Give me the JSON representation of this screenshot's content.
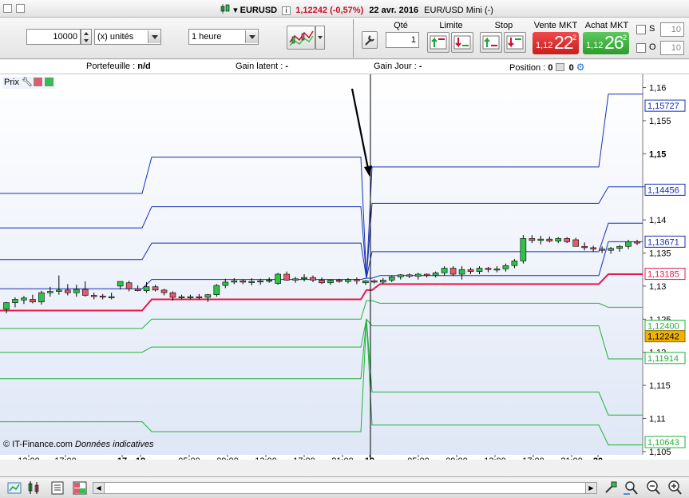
{
  "titlebar": {
    "symbol": "EURUSD",
    "price": "1,12242",
    "change": "(-0,57%)",
    "date": "22 avr. 2016",
    "instrument": "EUR/USD Mini (-)"
  },
  "toolbar": {
    "quantity": "10000",
    "unit": "(x) unités",
    "timeframe": "1 heure",
    "qty_label": "Qté",
    "qty_value": "1",
    "limit_label": "Limite",
    "stop_label": "Stop",
    "sell_label": "Vente MKT",
    "buy_label": "Achat MKT",
    "sell_pre": "1,12",
    "sell_big": "22",
    "sell_sup": "2",
    "buy_pre": "1,12",
    "buy_big": "26",
    "buy_sup": "2",
    "s_label": "S",
    "o_label": "O",
    "s_value": "10",
    "o_value": "10"
  },
  "infobar": {
    "portfolio_label": "Portefeuille :",
    "portfolio_value": "n/d",
    "latent_label": "Gain latent :",
    "latent_value": "-",
    "day_label": "Gain Jour :",
    "day_value": "-",
    "position_label": "Position :",
    "position_value": "0",
    "position_value2": "0"
  },
  "chart": {
    "prix_label": "Prix",
    "footer_source": "© IT-Finance.com",
    "footer_note": "Données indicatives"
  },
  "colors": {
    "up": "#2fc24a",
    "down": "#e05b6c",
    "mid_line": "#e8174a",
    "upper_band": "#1630b8",
    "lower_band": "#1fb23a",
    "current": "#f0b400"
  },
  "chart_data": {
    "type": "candlestick",
    "y_range": [
      1.104,
      1.162
    ],
    "y_ticks": [
      "1,16",
      "1,155",
      "1,15",
      "1,145",
      "1,14",
      "1,135",
      "1,13",
      "1,125",
      "1,12",
      "1,115",
      "1,11",
      "1,105"
    ],
    "x_labels": [
      {
        "label": "13:00",
        "bold": false
      },
      {
        "label": "17:00",
        "bold": false
      },
      {
        "label": "17",
        "bold": true
      },
      {
        "label": "18",
        "bold": true
      },
      {
        "label": "05:00",
        "bold": false
      },
      {
        "label": "09:00",
        "bold": false
      },
      {
        "label": "13:00",
        "bold": false
      },
      {
        "label": "17:00",
        "bold": false
      },
      {
        "label": "21:00",
        "bold": false
      },
      {
        "label": "19",
        "bold": true
      },
      {
        "label": "05:00",
        "bold": false
      },
      {
        "label": "09:00",
        "bold": false
      },
      {
        "label": "13:00",
        "bold": false
      },
      {
        "label": "17:00",
        "bold": false
      },
      {
        "label": "21:00",
        "bold": false
      },
      {
        "label": "20",
        "bold": true
      }
    ],
    "price_tags": [
      {
        "value": "1,15727",
        "kind": "upper",
        "price": 1.15727
      },
      {
        "value": "1,14456",
        "kind": "upper",
        "price": 1.14456
      },
      {
        "value": "1,13671",
        "kind": "upper",
        "price": 1.13671
      },
      {
        "value": "1,13185",
        "kind": "mid",
        "price": 1.13185
      },
      {
        "value": "1,12400",
        "kind": "lower",
        "price": 1.124
      },
      {
        "value": "1,12242",
        "kind": "current",
        "price": 1.12242
      },
      {
        "value": "1,11914",
        "kind": "lower",
        "price": 1.11914
      },
      {
        "value": "1,10643",
        "kind": "lower",
        "price": 1.10643
      }
    ],
    "candles": [
      [
        1.1265,
        1.1276,
        1.1259,
        1.1275
      ],
      [
        1.1275,
        1.1283,
        1.1268,
        1.128
      ],
      [
        1.1279,
        1.1285,
        1.1273,
        1.1282
      ],
      [
        1.128,
        1.1287,
        1.1274,
        1.1276
      ],
      [
        1.1276,
        1.1293,
        1.1272,
        1.129
      ],
      [
        1.129,
        1.1299,
        1.1284,
        1.1292
      ],
      [
        1.1292,
        1.1316,
        1.1287,
        1.1294
      ],
      [
        1.1294,
        1.1303,
        1.1286,
        1.129
      ],
      [
        1.129,
        1.1302,
        1.1284,
        1.1295
      ],
      [
        1.1295,
        1.1307,
        1.1284,
        1.1286
      ],
      [
        1.1286,
        1.129,
        1.128,
        1.1285
      ],
      [
        1.1285,
        1.1288,
        1.128,
        1.1284
      ],
      [
        1.1284,
        1.129,
        1.128,
        1.1284
      ],
      [
        1.13,
        1.1307,
        1.1295,
        1.1307
      ],
      [
        1.1305,
        1.1308,
        1.1292,
        1.1296
      ],
      [
        1.1296,
        1.1301,
        1.1292,
        1.1293
      ],
      [
        1.1293,
        1.1306,
        1.129,
        1.1299
      ],
      [
        1.1299,
        1.1302,
        1.1292,
        1.1294
      ],
      [
        1.1294,
        1.1296,
        1.1286,
        1.129
      ],
      [
        1.129,
        1.1292,
        1.1278,
        1.1283
      ],
      [
        1.1283,
        1.1287,
        1.128,
        1.1284
      ],
      [
        1.1284,
        1.1287,
        1.128,
        1.1284
      ],
      [
        1.1284,
        1.1288,
        1.128,
        1.1283
      ],
      [
        1.1283,
        1.1288,
        1.1276,
        1.1287
      ],
      [
        1.1287,
        1.1303,
        1.1284,
        1.1301
      ],
      [
        1.1301,
        1.1311,
        1.1297,
        1.1306
      ],
      [
        1.1306,
        1.1312,
        1.1303,
        1.1308
      ],
      [
        1.1308,
        1.131,
        1.1303,
        1.1306
      ],
      [
        1.1306,
        1.1312,
        1.1301,
        1.1307
      ],
      [
        1.1307,
        1.1311,
        1.1302,
        1.1308
      ],
      [
        1.1308,
        1.1313,
        1.1305,
        1.1309
      ],
      [
        1.1304,
        1.132,
        1.1302,
        1.1318
      ],
      [
        1.1318,
        1.1322,
        1.1308,
        1.1309
      ],
      [
        1.1309,
        1.1314,
        1.1305,
        1.1311
      ],
      [
        1.1311,
        1.1318,
        1.1307,
        1.1313
      ],
      [
        1.1313,
        1.1316,
        1.1306,
        1.1309
      ],
      [
        1.1309,
        1.1313,
        1.1303,
        1.1305
      ],
      [
        1.1305,
        1.131,
        1.1302,
        1.1309
      ],
      [
        1.1309,
        1.1311,
        1.1305,
        1.1307
      ],
      [
        1.1307,
        1.1312,
        1.1304,
        1.131
      ],
      [
        1.131,
        1.1313,
        1.1303,
        1.1308
      ],
      [
        1.1305,
        1.1309,
        1.1302,
        1.1308
      ],
      [
        1.1308,
        1.131,
        1.1304,
        1.1306
      ],
      [
        1.1306,
        1.1312,
        1.1303,
        1.1309
      ],
      [
        1.1309,
        1.1316,
        1.1306,
        1.1314
      ],
      [
        1.1314,
        1.1318,
        1.131,
        1.1317
      ],
      [
        1.1317,
        1.1319,
        1.1312,
        1.1315
      ],
      [
        1.1315,
        1.132,
        1.131,
        1.1318
      ],
      [
        1.1318,
        1.1319,
        1.1313,
        1.1316
      ],
      [
        1.1316,
        1.1322,
        1.1313,
        1.132
      ],
      [
        1.132,
        1.133,
        1.1316,
        1.1327
      ],
      [
        1.1327,
        1.133,
        1.1315,
        1.1318
      ],
      [
        1.1318,
        1.133,
        1.131,
        1.1325
      ],
      [
        1.1325,
        1.1328,
        1.1318,
        1.1322
      ],
      [
        1.1322,
        1.133,
        1.1318,
        1.1327
      ],
      [
        1.1327,
        1.1329,
        1.1321,
        1.1325
      ],
      [
        1.1325,
        1.133,
        1.1321,
        1.1326
      ],
      [
        1.1326,
        1.1334,
        1.1322,
        1.1331
      ],
      [
        1.1331,
        1.1341,
        1.1327,
        1.1338
      ],
      [
        1.1338,
        1.1377,
        1.1334,
        1.1372
      ],
      [
        1.1372,
        1.1377,
        1.1365,
        1.1369
      ],
      [
        1.1369,
        1.1376,
        1.1363,
        1.1371
      ],
      [
        1.1371,
        1.1375,
        1.1366,
        1.1368
      ],
      [
        1.1368,
        1.1374,
        1.1365,
        1.1372
      ],
      [
        1.1372,
        1.1374,
        1.1365,
        1.1367
      ],
      [
        1.137,
        1.1373,
        1.1362,
        1.136
      ],
      [
        1.136,
        1.1366,
        1.1354,
        1.1358
      ],
      [
        1.1358,
        1.1361,
        1.1352,
        1.1356
      ],
      [
        1.1356,
        1.136,
        1.135,
        1.1354
      ],
      [
        1.1354,
        1.1359,
        1.1349,
        1.1357
      ],
      [
        1.1357,
        1.1362,
        1.1352,
        1.136
      ],
      [
        1.136,
        1.137,
        1.1356,
        1.1367
      ],
      [
        1.1367,
        1.137,
        1.1362,
        1.1365
      ]
    ],
    "bands": {
      "x": [
        0,
        178,
        190,
        452,
        459,
        466,
        476,
        750,
        762,
        805
      ],
      "mid": [
        1.1263,
        1.1263,
        1.128,
        1.128,
        1.1294,
        1.1294,
        1.1303,
        1.1303,
        1.1318,
        1.1318
      ],
      "up1": [
        1.1296,
        1.1296,
        1.131,
        1.131,
        1.1312,
        1.1312,
        1.1316,
        1.1316,
        1.1367,
        1.1367
      ],
      "up2": [
        1.134,
        1.134,
        1.1365,
        1.1365,
        1.1312,
        1.1352,
        1.1352,
        1.1352,
        1.1395,
        1.1395
      ],
      "up3": [
        1.1388,
        1.1388,
        1.142,
        1.142,
        1.1312,
        1.1425,
        1.1425,
        1.1425,
        1.145,
        1.145
      ],
      "up4": [
        1.144,
        1.144,
        1.1495,
        1.1495,
        1.1312,
        1.148,
        1.148,
        1.148,
        1.159,
        1.159
      ],
      "lo1": [
        1.1236,
        1.1236,
        1.125,
        1.125,
        1.1278,
        1.1278,
        1.1274,
        1.1274,
        1.1268,
        1.1268
      ],
      "lo2": [
        1.12,
        1.12,
        1.1208,
        1.1208,
        1.125,
        1.124,
        1.124,
        1.124,
        1.119,
        1.119
      ],
      "lo3": [
        1.116,
        1.116,
        1.116,
        1.116,
        1.125,
        1.114,
        1.114,
        1.114,
        1.1105,
        1.1105
      ],
      "lo4": [
        1.1095,
        1.1095,
        1.108,
        1.108,
        1.125,
        1.109,
        1.109,
        1.109,
        1.106,
        1.106
      ]
    }
  }
}
